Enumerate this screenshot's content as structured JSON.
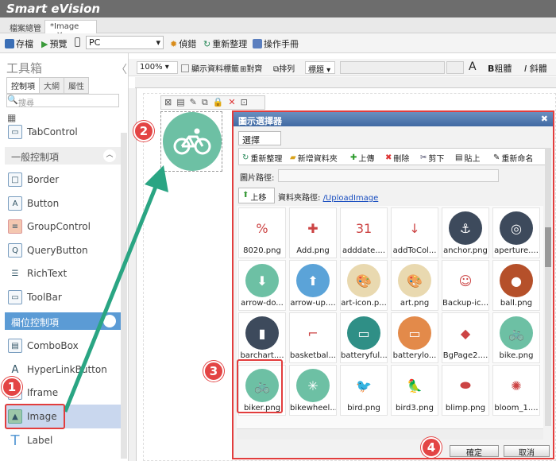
{
  "app": {
    "title": "Smart eVision"
  },
  "doc_tabs": [
    {
      "label": "檔案總管"
    },
    {
      "label": "*Image"
    }
  ],
  "toolbar": {
    "save": "存檔",
    "preview": "預覽",
    "device": "PC",
    "debug": "偵錯",
    "refresh": "重新整理",
    "manual": "操作手冊"
  },
  "format_bar": {
    "zoom": "100%",
    "show_labels": "顯示資料標籤",
    "align": "對齊",
    "arrange": "排列",
    "heading": "標題",
    "bold": "粗體",
    "italic": "斜體"
  },
  "left_panel": {
    "title": "工具箱",
    "tabs": [
      "控制項",
      "大綱",
      "屬性"
    ],
    "search_placeholder": "搜尋",
    "items_top": [
      {
        "label": "TabControl"
      }
    ],
    "section_general": "一般控制項",
    "general_items": [
      {
        "label": "Border"
      },
      {
        "label": "Button"
      },
      {
        "label": "GroupControl"
      },
      {
        "label": "QueryButton"
      },
      {
        "label": "RichText"
      },
      {
        "label": "ToolBar"
      }
    ],
    "section_field": "欄位控制項",
    "field_items": [
      {
        "label": "ComboBox"
      },
      {
        "label": "HyperLinkButton"
      },
      {
        "label": "Iframe"
      },
      {
        "label": "Image"
      },
      {
        "label": "Label"
      }
    ]
  },
  "dialog": {
    "title": "圖示選擇器",
    "tab": "選擇image",
    "actions": [
      "重新整理",
      "新增資料夾",
      "上傳",
      "刪除",
      "剪下",
      "貼上",
      "重新命名"
    ],
    "image_path_label": "圖片路徑:",
    "up_label": "上移",
    "folder_path_label": "資料夾路徑:",
    "folder_path": "/UploadImage",
    "images": [
      {
        "name": "8020.png",
        "color": "#ffffff",
        "glyph": "%"
      },
      {
        "name": "Add.png",
        "color": "#ffffff",
        "glyph": "✚"
      },
      {
        "name": "adddate....",
        "color": "#ffffff",
        "glyph": "31"
      },
      {
        "name": "addToCol...",
        "color": "#ffffff",
        "glyph": "↓"
      },
      {
        "name": "anchor.png",
        "color": "#3d4a5c",
        "glyph": "⚓"
      },
      {
        "name": "aperture....",
        "color": "#3d4a5c",
        "glyph": "◎"
      },
      {
        "name": "arrow-do...",
        "color": "#6dc0a4",
        "glyph": "⬇"
      },
      {
        "name": "arrow-up....",
        "color": "#5ba3d8",
        "glyph": "⬆"
      },
      {
        "name": "art-icon.p...",
        "color": "#e9d9b0",
        "glyph": "🎨"
      },
      {
        "name": "art.png",
        "color": "#e9d9b0",
        "glyph": "🎨"
      },
      {
        "name": "Backup-ic...",
        "color": "#ffffff",
        "glyph": "☺"
      },
      {
        "name": "ball.png",
        "color": "#b5502a",
        "glyph": "●"
      },
      {
        "name": "barchart....",
        "color": "#3d4a5c",
        "glyph": "▮"
      },
      {
        "name": "basketbal...",
        "color": "#ffffff",
        "glyph": "⌐"
      },
      {
        "name": "batteryful...",
        "color": "#2f8f86",
        "glyph": "▭"
      },
      {
        "name": "batterylo...",
        "color": "#e38a4a",
        "glyph": "▭"
      },
      {
        "name": "BgPage2....",
        "color": "#ffffff",
        "glyph": "◆"
      },
      {
        "name": "bike.png",
        "color": "#6dc0a4",
        "glyph": "🚲"
      },
      {
        "name": "biker.png",
        "color": "#6dc0a4",
        "glyph": "🚲"
      },
      {
        "name": "bikewheel...",
        "color": "#6dc0a4",
        "glyph": "✳"
      },
      {
        "name": "bird.png",
        "color": "#ffffff",
        "glyph": "🐦"
      },
      {
        "name": "bird3.png",
        "color": "#ffffff",
        "glyph": "🦜"
      },
      {
        "name": "blimp.png",
        "color": "#ffffff",
        "glyph": "⬬"
      },
      {
        "name": "bloom_1....",
        "color": "#ffffff",
        "glyph": "✺"
      }
    ],
    "ok": "確定",
    "cancel": "取消"
  },
  "callouts": [
    "1",
    "2",
    "3",
    "4"
  ],
  "colors": {
    "accent_red": "#e23d3d",
    "teal": "#6dc0a4",
    "highlight_blue": "#5b9bd5"
  }
}
